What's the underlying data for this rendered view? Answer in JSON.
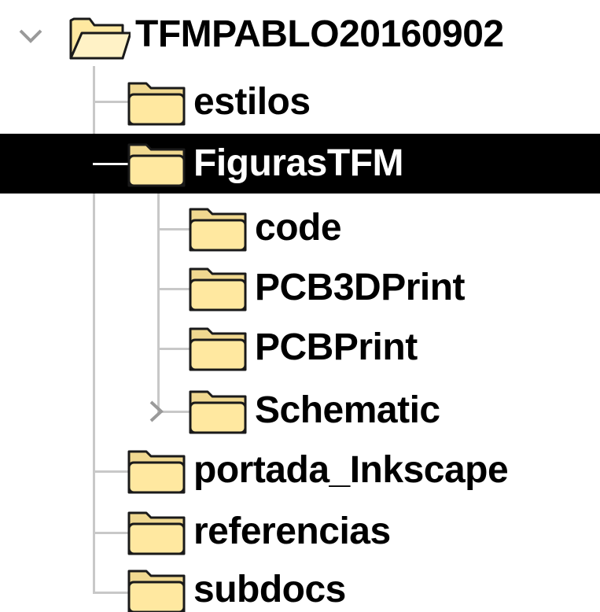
{
  "tree": {
    "root": {
      "label": "TFMPABLO20160902",
      "expanded": true
    },
    "children": [
      {
        "label": "estilos"
      },
      {
        "label": "FigurasTFM",
        "selected": true,
        "expanded": true,
        "children": [
          {
            "label": "code"
          },
          {
            "label": "PCB3DPrint"
          },
          {
            "label": "PCBPrint"
          },
          {
            "label": "Schematic",
            "has_children": true
          }
        ]
      },
      {
        "label": "portada_Inkscape"
      },
      {
        "label": "referencias"
      },
      {
        "label": "subdocs"
      }
    ]
  },
  "colors": {
    "selection_bg": "#000000",
    "tree_lines": "#c8c8c8",
    "folder_body": "#ffe8a0",
    "folder_outline": "#1a1a1a",
    "chevron": "#9a9a9a"
  },
  "icons": {
    "expand_arrow": "chevron-down-icon",
    "collapsed_arrow": "chevron-right-icon",
    "open_folder": "folder-open-icon",
    "closed_folder": "folder-icon"
  }
}
